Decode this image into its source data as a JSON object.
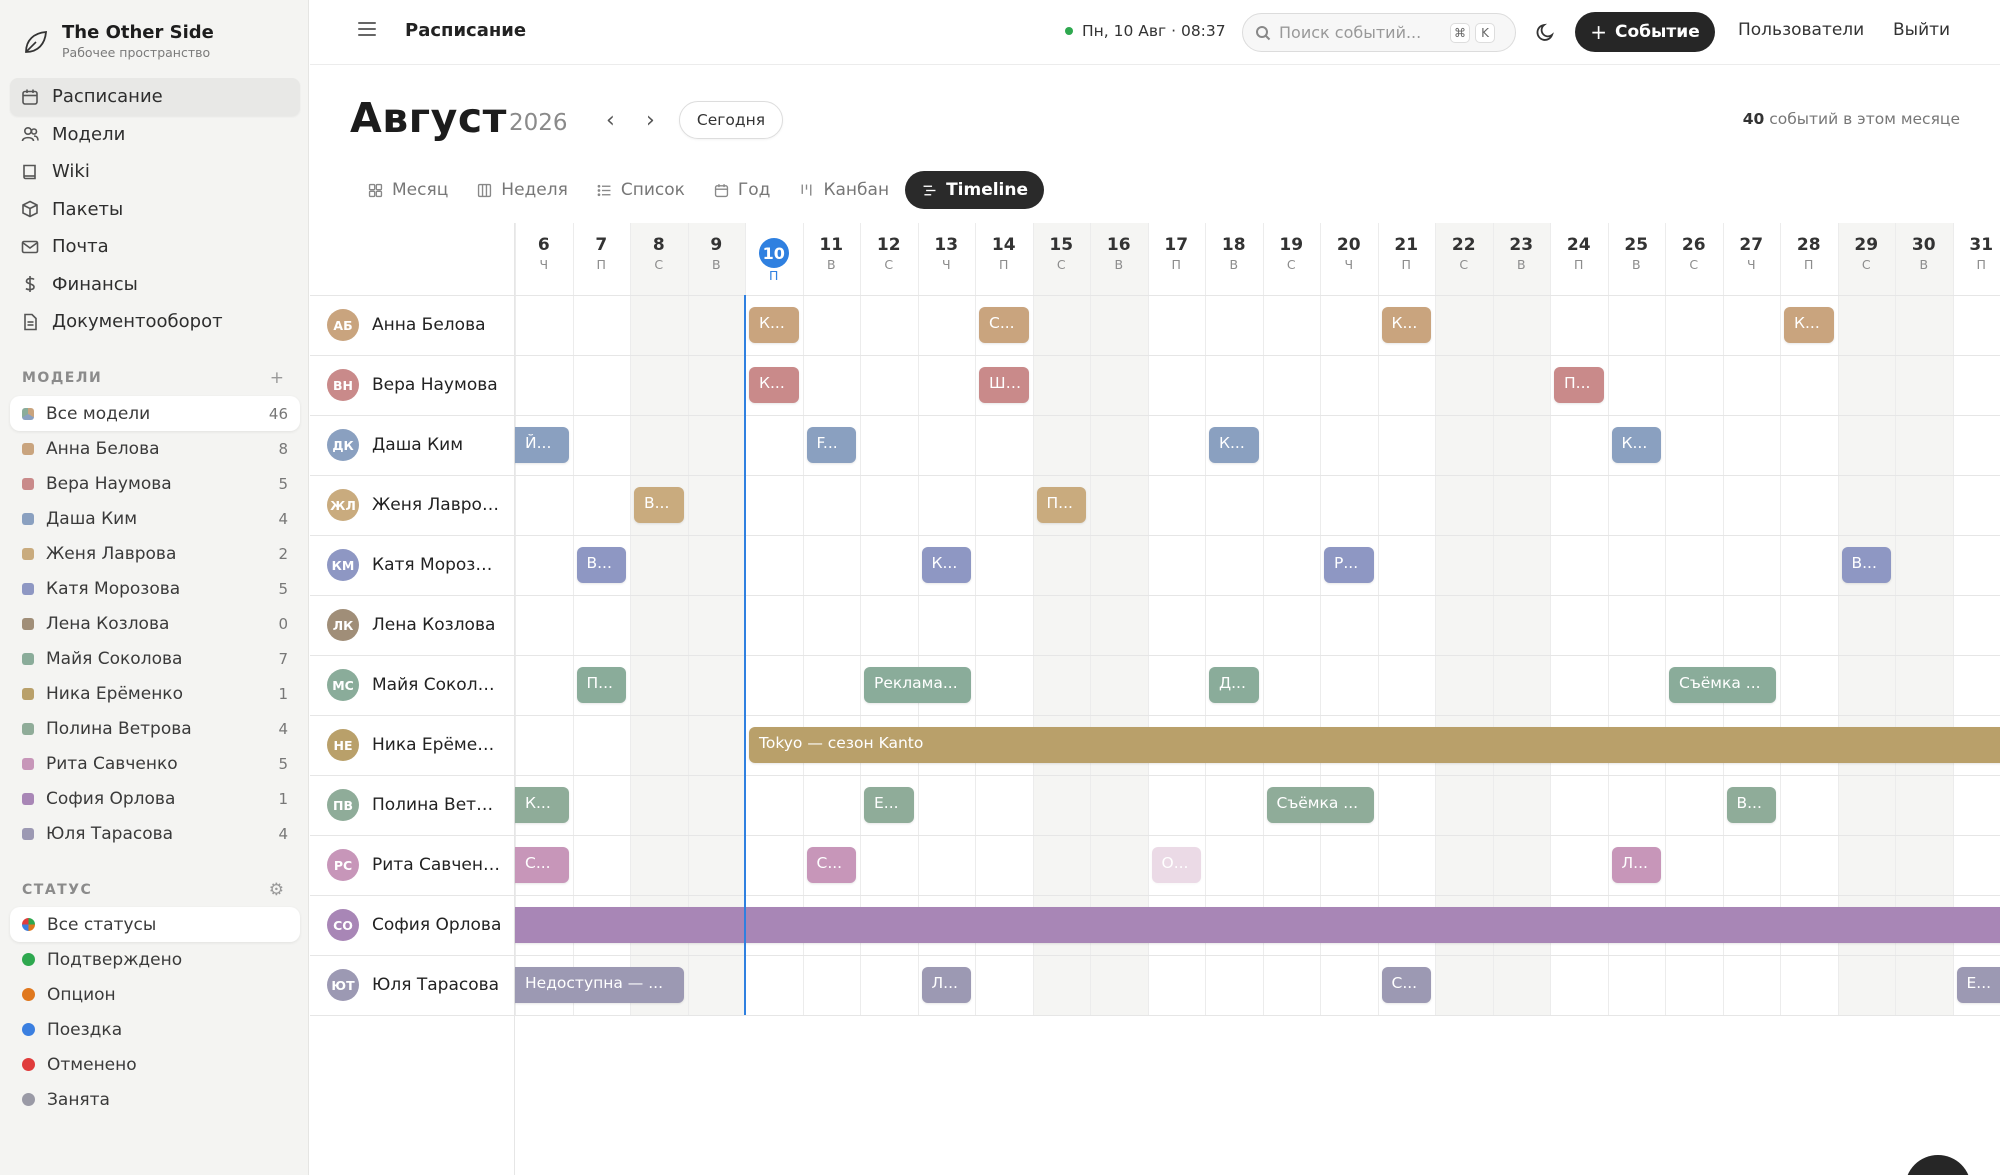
{
  "brand": {
    "title": "The Other Side",
    "subtitle": "Рабочее пространство"
  },
  "nav": [
    {
      "label": "Расписание",
      "icon": "calendar-icon",
      "active": true
    },
    {
      "label": "Модели",
      "icon": "users-icon"
    },
    {
      "label": "Wiki",
      "icon": "book-icon"
    },
    {
      "label": "Пакеты",
      "icon": "package-icon"
    },
    {
      "label": "Почта",
      "icon": "mail-icon"
    },
    {
      "label": "Финансы",
      "icon": "dollar-icon"
    },
    {
      "label": "Документооборот",
      "icon": "document-icon"
    }
  ],
  "models_section": {
    "title": "МОДЕЛИ",
    "add": "+",
    "items": [
      {
        "label": "Все модели",
        "count": "46",
        "color": "multicolor",
        "active": true
      },
      {
        "label": "Анна Белова",
        "count": "8",
        "color": "#c9a47e"
      },
      {
        "label": "Вера Наумова",
        "count": "5",
        "color": "#c98a8a"
      },
      {
        "label": "Даша Ким",
        "count": "4",
        "color": "#8aa0c0"
      },
      {
        "label": "Женя Лаврова",
        "count": "2",
        "color": "#c9ab7e"
      },
      {
        "label": "Катя Морозова",
        "count": "5",
        "color": "#8e97c3"
      },
      {
        "label": "Лена Козлова",
        "count": "0",
        "color": "#a08e78"
      },
      {
        "label": "Майя Соколова",
        "count": "7",
        "color": "#8aac9a"
      },
      {
        "label": "Ника Ерёменко",
        "count": "1",
        "color": "#b9a06a"
      },
      {
        "label": "Полина Ветрова",
        "count": "4",
        "color": "#8fac99"
      },
      {
        "label": "Рита Савченко",
        "count": "5",
        "color": "#c796b9"
      },
      {
        "label": "София Орлова",
        "count": "1",
        "color": "#a886b6"
      },
      {
        "label": "Юля Тарасова",
        "count": "4",
        "color": "#9c99b3"
      }
    ]
  },
  "status_section": {
    "title": "СТАТУС",
    "settings_icon": "gear-icon",
    "items": [
      {
        "label": "Все статусы",
        "color": "multicolor",
        "active": true
      },
      {
        "label": "Подтверждено",
        "color": "#2ea84f"
      },
      {
        "label": "Опцион",
        "color": "#e0781e"
      },
      {
        "label": "Поездка",
        "color": "#3b7fe0"
      },
      {
        "label": "Отменено",
        "color": "#e03c3c"
      },
      {
        "label": "Занята",
        "color": "#9a9aa6"
      }
    ]
  },
  "header": {
    "title": "Расписание",
    "clock": "Пн, 10 Авг · 08:37",
    "search_placeholder": "Поиск событий...",
    "kbd_cmd": "⌘",
    "kbd_key": "K",
    "new_event": "Событие",
    "users": "Пользователи",
    "logout": "Выйти"
  },
  "calendar": {
    "month": "Август",
    "year": "2026",
    "prev": "‹",
    "next": "›",
    "today_btn": "Сегодня",
    "events_count": "40",
    "events_count_suffix": "событий в этом месяце",
    "views": [
      {
        "label": "Месяц",
        "icon": "grid-icon"
      },
      {
        "label": "Неделя",
        "icon": "columns-icon"
      },
      {
        "label": "Список",
        "icon": "list-icon"
      },
      {
        "label": "Год",
        "icon": "calendar-icon"
      },
      {
        "label": "Канбан",
        "icon": "kanban-icon"
      },
      {
        "label": "Timeline",
        "icon": "timeline-icon",
        "active": true
      }
    ],
    "today_day": 10,
    "days": [
      {
        "n": "6",
        "w": "Ч"
      },
      {
        "n": "7",
        "w": "П"
      },
      {
        "n": "8",
        "w": "С",
        "we": true
      },
      {
        "n": "9",
        "w": "В",
        "we": true
      },
      {
        "n": "10",
        "w": "П"
      },
      {
        "n": "11",
        "w": "В"
      },
      {
        "n": "12",
        "w": "С"
      },
      {
        "n": "13",
        "w": "Ч"
      },
      {
        "n": "14",
        "w": "П"
      },
      {
        "n": "15",
        "w": "С",
        "we": true
      },
      {
        "n": "16",
        "w": "В",
        "we": true
      },
      {
        "n": "17",
        "w": "П"
      },
      {
        "n": "18",
        "w": "В"
      },
      {
        "n": "19",
        "w": "С"
      },
      {
        "n": "20",
        "w": "Ч"
      },
      {
        "n": "21",
        "w": "П"
      },
      {
        "n": "22",
        "w": "С",
        "we": true
      },
      {
        "n": "23",
        "w": "В",
        "we": true
      },
      {
        "n": "24",
        "w": "П"
      },
      {
        "n": "25",
        "w": "В"
      },
      {
        "n": "26",
        "w": "С"
      },
      {
        "n": "27",
        "w": "Ч"
      },
      {
        "n": "28",
        "w": "П"
      },
      {
        "n": "29",
        "w": "С",
        "we": true
      },
      {
        "n": "30",
        "w": "В",
        "we": true
      },
      {
        "n": "31",
        "w": "П"
      }
    ],
    "rows": [
      {
        "name": "Анна Белова",
        "initials": "АБ",
        "color": "#c9a47e",
        "events": [
          {
            "s": 10,
            "e": 10,
            "t": "К..."
          },
          {
            "s": 14,
            "e": 14,
            "t": "С..."
          },
          {
            "s": 21,
            "e": 21,
            "t": "К..."
          },
          {
            "s": 28,
            "e": 28,
            "t": "К..."
          }
        ]
      },
      {
        "name": "Вера Наумова",
        "initials": "ВН",
        "color": "#c98a8a",
        "events": [
          {
            "s": 10,
            "e": 10,
            "t": "К..."
          },
          {
            "s": 14,
            "e": 14,
            "t": "Ш..."
          },
          {
            "s": 24,
            "e": 24,
            "t": "П..."
          }
        ]
      },
      {
        "name": "Даша Ким",
        "initials": "ДК",
        "color": "#8aa0c0",
        "events": [
          {
            "s": 6,
            "e": 6,
            "t": "Й...",
            "cut": true
          },
          {
            "s": 11,
            "e": 11,
            "t": "F..."
          },
          {
            "s": 18,
            "e": 18,
            "t": "К..."
          },
          {
            "s": 25,
            "e": 25,
            "t": "К..."
          }
        ]
      },
      {
        "name": "Женя Лаврова",
        "initials": "ЖЛ",
        "color": "#c9ab7e",
        "events": [
          {
            "s": 8,
            "e": 8,
            "t": "В..."
          },
          {
            "s": 15,
            "e": 15,
            "t": "П..."
          }
        ]
      },
      {
        "name": "Катя Морозова",
        "initials": "КМ",
        "color": "#8e97c3",
        "events": [
          {
            "s": 7,
            "e": 7,
            "t": "В..."
          },
          {
            "s": 13,
            "e": 13,
            "t": "К..."
          },
          {
            "s": 20,
            "e": 20,
            "t": "Р..."
          },
          {
            "s": 29,
            "e": 29,
            "t": "В..."
          }
        ]
      },
      {
        "name": "Лена Козлова",
        "initials": "ЛК",
        "color": "#a08e78",
        "events": []
      },
      {
        "name": "Майя Соколова",
        "initials": "МС",
        "color": "#8aac9a",
        "events": [
          {
            "s": 7,
            "e": 7,
            "t": "П..."
          },
          {
            "s": 12,
            "e": 13,
            "t": "Реклама..."
          },
          {
            "s": 18,
            "e": 18,
            "t": "Д..."
          },
          {
            "s": 26,
            "e": 27,
            "t": "Съёмка ..."
          }
        ]
      },
      {
        "name": "Ника Ерёменко",
        "initials": "НЕ",
        "color": "#b9a06a",
        "events": [
          {
            "s": 10,
            "e": 31,
            "t": "Tokyo — сезон Kanto"
          }
        ]
      },
      {
        "name": "Полина Ветрова",
        "initials": "ПВ",
        "color": "#8fac99",
        "events": [
          {
            "s": 6,
            "e": 6,
            "t": "К...",
            "cut": true
          },
          {
            "s": 12,
            "e": 12,
            "t": "Е..."
          },
          {
            "s": 19,
            "e": 20,
            "t": "Съёмка ..."
          },
          {
            "s": 27,
            "e": 27,
            "t": "В..."
          }
        ]
      },
      {
        "name": "Рита Савченко",
        "initials": "РС",
        "color": "#c796b9",
        "events": [
          {
            "s": 6,
            "e": 6,
            "t": "С...",
            "cut": true
          },
          {
            "s": 11,
            "e": 11,
            "t": "С..."
          },
          {
            "s": 17,
            "e": 17,
            "t": "О...",
            "faded": true
          },
          {
            "s": 25,
            "e": 25,
            "t": "Л..."
          }
        ]
      },
      {
        "name": "София Орлова",
        "initials": "СО",
        "color": "#a886b6",
        "events": [
          {
            "s": 6,
            "e": 31,
            "t": "",
            "cut": true
          }
        ]
      },
      {
        "name": "Юля Тарасова",
        "initials": "ЮТ",
        "color": "#9c99b3",
        "events": [
          {
            "s": 6,
            "e": 8,
            "t": "Недоступна — ...",
            "cut": true
          },
          {
            "s": 13,
            "e": 13,
            "t": "Л..."
          },
          {
            "s": 21,
            "e": 21,
            "t": "С..."
          },
          {
            "s": 31,
            "e": 31,
            "t": "Е..."
          }
        ]
      }
    ]
  }
}
